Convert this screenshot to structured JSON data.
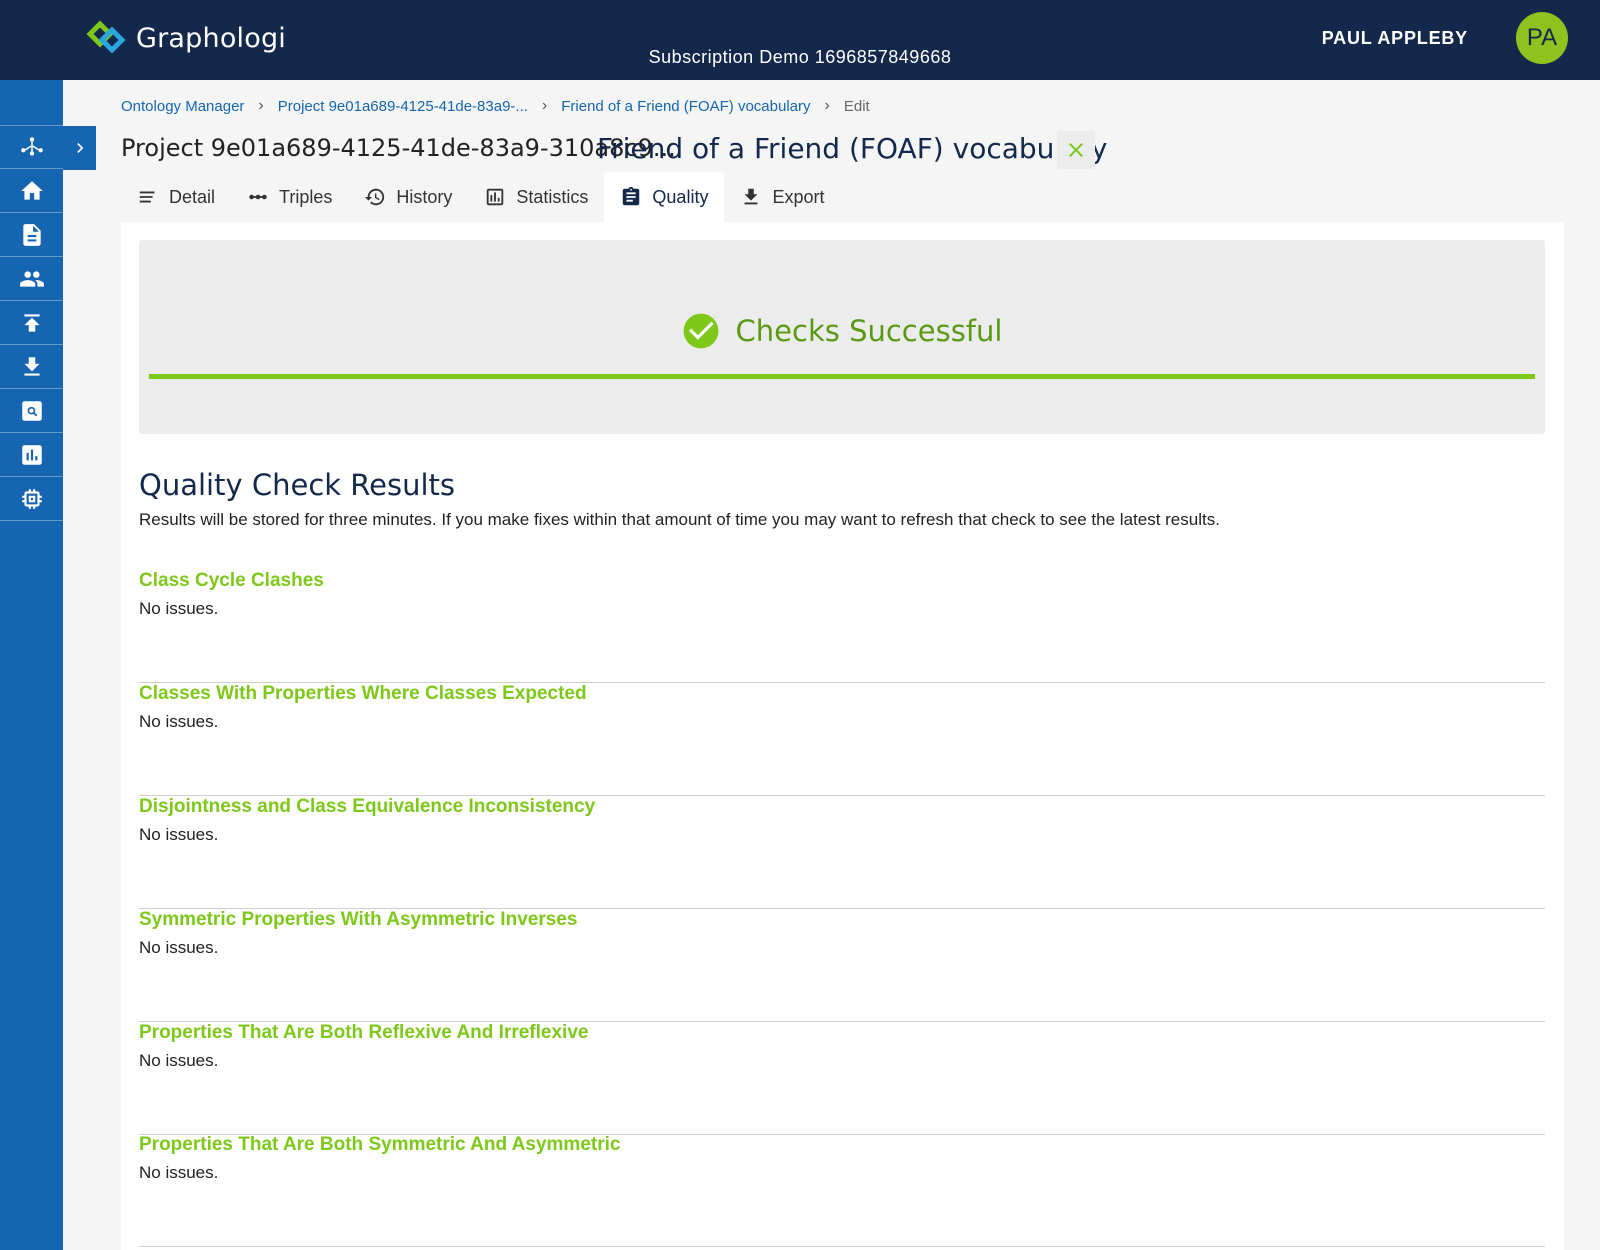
{
  "app": {
    "brand": "Graphologi",
    "subscription": "Subscription Demo 1696857849668",
    "user_name": "PAUL APPLEBY",
    "user_initials": "PA"
  },
  "sidebar": {
    "items": [
      {
        "icon": "graph-icon",
        "label": "Graph"
      },
      {
        "icon": "home-icon",
        "label": "Home"
      },
      {
        "icon": "document-icon",
        "label": "Documents"
      },
      {
        "icon": "people-icon",
        "label": "Users"
      },
      {
        "icon": "upload-icon",
        "label": "Import"
      },
      {
        "icon": "download-icon",
        "label": "Export"
      },
      {
        "icon": "search-icon",
        "label": "Search"
      },
      {
        "icon": "chart-icon",
        "label": "Statistics"
      },
      {
        "icon": "chip-icon",
        "label": "Settings"
      }
    ]
  },
  "breadcrumb": {
    "items": [
      "Ontology Manager",
      "Project 9e01a689-4125-41de-83a9-...",
      "Friend of a Friend (FOAF) vocabulary"
    ],
    "current": "Edit"
  },
  "header": {
    "project_title": "Project 9e01a689-4125-41de-83a9-310a8c9...",
    "vocab_title": "Friend of a Friend (FOAF) vocabulary"
  },
  "tabs": [
    {
      "label": "Detail",
      "icon": "list-icon",
      "active": false
    },
    {
      "label": "Triples",
      "icon": "dots-icon",
      "active": false
    },
    {
      "label": "History",
      "icon": "history-icon",
      "active": false
    },
    {
      "label": "Statistics",
      "icon": "bar-chart-icon",
      "active": false
    },
    {
      "label": "Quality",
      "icon": "clipboard-icon",
      "active": true
    },
    {
      "label": "Export",
      "icon": "download-icon",
      "active": false
    }
  ],
  "status": {
    "text": "Checks Successful",
    "progress": 1.0,
    "color": "#7ec81a"
  },
  "results": {
    "title": "Quality Check Results",
    "description": "Results will be stored for three minutes. If you make fixes within that amount of time you may want to refresh that check to see the latest results.",
    "checks": [
      {
        "title": "Class Cycle Clashes",
        "result": "No issues."
      },
      {
        "title": "Classes With Properties Where Classes Expected",
        "result": "No issues."
      },
      {
        "title": "Disjointness and Class Equivalence Inconsistency",
        "result": "No issues."
      },
      {
        "title": "Symmetric Properties With Asymmetric Inverses",
        "result": "No issues."
      },
      {
        "title": "Properties That Are Both Reflexive And Irreflexive",
        "result": "No issues."
      },
      {
        "title": "Properties That Are Both Symmetric And Asymmetric",
        "result": "No issues."
      }
    ]
  },
  "colors": {
    "topbar": "#13284b",
    "sidebar": "#1565b0",
    "accent_green": "#7ec81a",
    "link_blue": "#1565b0"
  }
}
